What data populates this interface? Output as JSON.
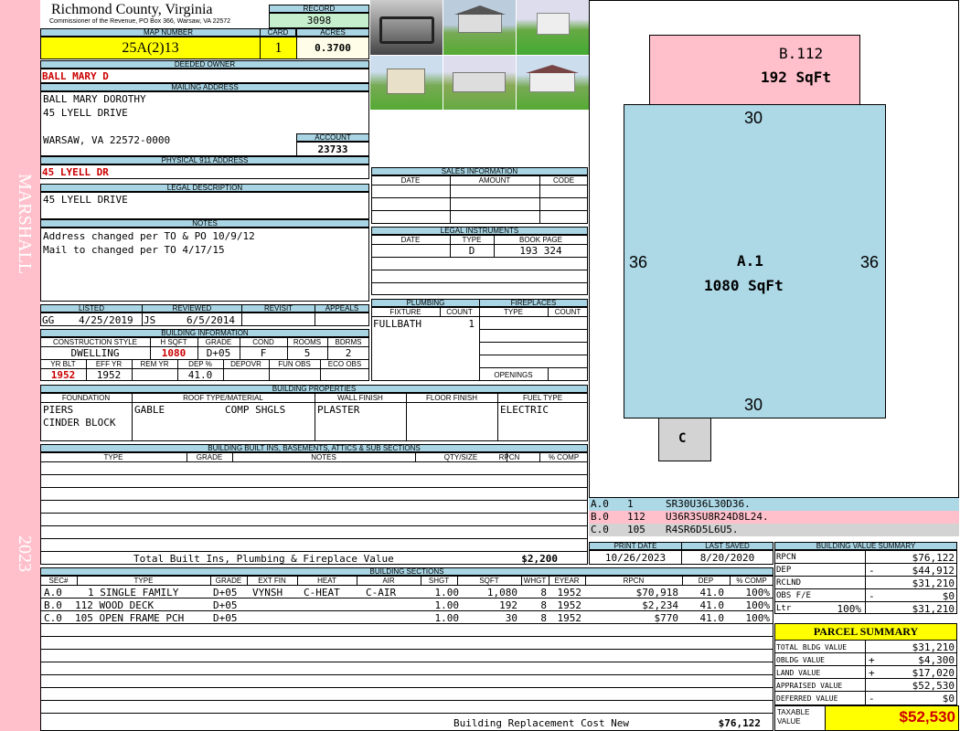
{
  "header": {
    "county": "Richmond County, Virginia",
    "address": "Commissioner of the Revenue, PO Box 366, Warsaw, VA 22572"
  },
  "labels": {
    "record": "RECORD",
    "map_number": "MAP NUMBER",
    "card": "CARD",
    "acres": "ACRES",
    "deeded_owner": "DEEDED OWNER",
    "mailing_address": "MAILING ADDRESS",
    "account": "ACCOUNT",
    "physical_address": "PHYSICAL 911 ADDRESS",
    "legal_description": "LEGAL DESCRIPTION",
    "notes": "NOTES",
    "listed": "LISTED",
    "reviewed": "REVIEWED",
    "revisit": "REVISIT",
    "appeals": "APPEALS",
    "building_information": "BUILDING INFORMATION",
    "sales_information": "SALES INFORMATION",
    "legal_instruments": "LEGAL INSTRUMENTS",
    "plumbing": "PLUMBING",
    "fireplaces": "FIREPLACES",
    "openings": "OPENINGS",
    "building_properties": "BUILDING PROPERTIES",
    "built_ins": "BUILDING BUILT INS, BASEMENTS, ATTICS & SUB SECTIONS",
    "building_sections": "BUILDING SECTIONS",
    "print_date": "PRINT DATE",
    "last_saved": "LAST SAVED",
    "bvs": "BUILDING VALUE SUMMARY",
    "parcel_summary": "PARCEL SUMMARY",
    "taxable_value": "TAXABLE VALUE"
  },
  "side": {
    "district": "MARSHALL",
    "year": "2023"
  },
  "record": {
    "number": "3098",
    "map_number": "25A(2)13",
    "card": "1",
    "acres": "0.3700"
  },
  "owner": {
    "deeded": "BALL MARY D",
    "mailing_line1": "BALL MARY DOROTHY",
    "mailing_line2": "45 LYELL DRIVE",
    "mailing_line3": "WARSAW, VA 22572-0000",
    "account": "23733",
    "physical": "45 LYELL DR",
    "legal": "45 LYELL DRIVE",
    "notes_line1": "Address changed per TO & PO 10/9/12",
    "notes_line2": "Mail to changed per TO 4/17/15"
  },
  "listing": {
    "listed_by": "GG",
    "listed_date": "4/25/2019",
    "reviewed_by": "JS",
    "reviewed_date": "6/5/2014"
  },
  "building_info": {
    "headers": [
      "CONSTRUCTION STYLE",
      "H SQFT",
      "GRADE",
      "COND",
      "ROOMS",
      "BDRMS"
    ],
    "style": "DWELLING",
    "hsqft": "1080",
    "grade": "D+05",
    "cond": "F",
    "rooms": "5",
    "bdrms": "2",
    "headers2": [
      "YR BLT",
      "EFF YR",
      "REM YR",
      "DEP %",
      "DEPOVR",
      "FUN OBS",
      "ECO OBS"
    ],
    "yr_blt": "1952",
    "eff_yr": "1952",
    "dep": "41.0"
  },
  "sales": {
    "headers": [
      "DATE",
      "AMOUNT",
      "CODE"
    ]
  },
  "legal_instruments": {
    "headers": [
      "DATE",
      "TYPE",
      "BOOK PAGE"
    ],
    "type": "D",
    "book_page": "193 324"
  },
  "plumbing": {
    "headers": [
      "FIXTURE",
      "COUNT"
    ],
    "fixture": "FULLBATH",
    "count": "1"
  },
  "fireplaces": {
    "headers": [
      "TYPE",
      "COUNT"
    ]
  },
  "properties": {
    "headers": [
      "FOUNDATION",
      "ROOF TYPE/MATERIAL",
      "WALL FINISH",
      "FLOOR FINISH",
      "FUEL TYPE"
    ],
    "foundation1": "PIERS",
    "foundation2": "CINDER BLOCK",
    "roof_type": "GABLE",
    "roof_material": "COMP SHGLS",
    "wall": "PLASTER",
    "fuel": "ELECTRIC"
  },
  "built_ins": {
    "headers": [
      "TYPE",
      "GRADE",
      "NOTES",
      "QTY/SIZE",
      "RPCN",
      "% COMP"
    ],
    "total_label": "Total Built Ins, Plumbing & Fireplace Value",
    "total_value": "$2,200"
  },
  "sections": {
    "headers": [
      "SEC#",
      "TYPE",
      "GRADE",
      "EXT FIN",
      "HEAT",
      "AIR",
      "SHGT",
      "SQFT",
      "WHGT",
      "EYEAR",
      "RPCN",
      "DEP",
      "% COMP"
    ],
    "rows": [
      {
        "sec": "A.0",
        "type": "1 SINGLE FAMILY",
        "grade": "D+05",
        "ext": "VYNSH",
        "heat": "C-HEAT",
        "air": "C-AIR",
        "shgt": "1.00",
        "sqft": "1,080",
        "whgt": "8",
        "eyear": "1952",
        "rpcn": "$70,918",
        "dep": "41.0",
        "comp": "100%"
      },
      {
        "sec": "B.0",
        "type": "112 WOOD DECK",
        "grade": "D+05",
        "ext": "",
        "heat": "",
        "air": "",
        "shgt": "1.00",
        "sqft": "192",
        "whgt": "8",
        "eyear": "1952",
        "rpcn": "$2,234",
        "dep": "41.0",
        "comp": "100%"
      },
      {
        "sec": "C.0",
        "type": "105 OPEN FRAME PCH",
        "grade": "D+05",
        "ext": "",
        "heat": "",
        "air": "",
        "shgt": "1.00",
        "sqft": "30",
        "whgt": "8",
        "eyear": "1952",
        "rpcn": "$770",
        "dep": "41.0",
        "comp": "100%"
      }
    ],
    "brcn_label": "Building Replacement Cost New",
    "brcn_value": "$76,122"
  },
  "sketch": {
    "b_label": "B.112",
    "b_area": "192 SqFt",
    "a_label": "A.1",
    "a_area": "1080 SqFt",
    "top": "30",
    "bottom": "30",
    "left": "36",
    "right": "36",
    "c_label": "C"
  },
  "sketch_legend": [
    {
      "sec": "A.0",
      "code": "1",
      "path": "SR30U36L30D36."
    },
    {
      "sec": "B.0",
      "code": "112",
      "path": "U36R3SU8R24D8L24."
    },
    {
      "sec": "C.0",
      "code": "105",
      "path": "R4SR6D5L6U5."
    }
  ],
  "dates": {
    "print": "10/26/2023",
    "saved": "8/20/2020"
  },
  "value_summary": {
    "rpcn_label": "RPCN",
    "rpcn": "$76,122",
    "dep_label": "DEP",
    "dep_sign": "-",
    "dep": "$44,912",
    "rclnd_label": "RCLND",
    "rclnd": "$31,210",
    "obs_label": "OBS F/E",
    "obs_sign": "-",
    "obs": "$0",
    "ltr_label": "Ltr",
    "ltr_pct": "100%",
    "ltr": "$31,210"
  },
  "parcel": {
    "tbv_label": "TOTAL BLDG VALUE",
    "tbv": "$31,210",
    "obldg_label": "OBLDG VALUE",
    "obldg_sign": "+",
    "obldg": "$4,300",
    "land_label": "LAND VALUE",
    "land_sign": "+",
    "land": "$17,020",
    "appraised_label": "APPRAISED VALUE",
    "appraised": "$52,530",
    "deferred_label": "DEFERRED VALUE",
    "deferred_sign": "-",
    "deferred": "$0",
    "taxable": "$52,530"
  },
  "colors": {
    "header": "#a8d4e3",
    "yellow": "#ffff00",
    "green": "#c6efce",
    "pink": "#ffc0cb",
    "blue": "#add8e6",
    "sidebar": "#ffc0cb",
    "red": "#cc0000"
  }
}
